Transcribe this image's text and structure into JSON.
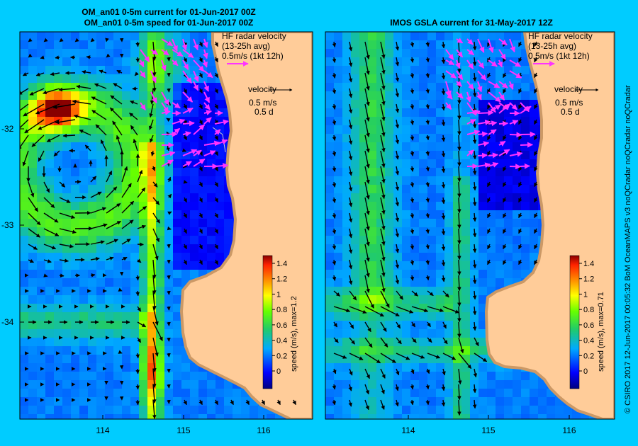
{
  "left_panel": {
    "title_line1": "OM_an01 0-5m current for 01-Jun-2017 00Z",
    "title_line2": "OM_an01 0-5m speed for 01-Jun-2017 00Z",
    "hf_legend": [
      "HF radar velocity",
      "(13-25h avg)",
      "0.5m/s (1kt 12h)"
    ],
    "velocity_legend": [
      "velocity",
      "0.5 m/s",
      "0.5 d"
    ],
    "colorbar_label": "speed (m/s), max=1.2",
    "lat_labels": [
      "-32",
      "-33",
      "-34"
    ],
    "lon_labels": [
      "114",
      "115",
      "116"
    ]
  },
  "right_panel": {
    "title": "IMOS GSLA current for 31-May-2017 12Z",
    "hf_legend": [
      "HF radar velocity",
      "(13-25h avg)",
      "0.5m/s (1kt 12h)"
    ],
    "velocity_legend": [
      "velocity",
      "0.5 m/s",
      "0.5 d"
    ],
    "colorbar_label": "speed (m/s), max=0.71",
    "lon_labels": [
      "114",
      "115",
      "116"
    ]
  },
  "colorbar_ticks": [
    "1.4",
    "1.2",
    "1",
    "0.8",
    "0.6",
    "0.4",
    "0.2",
    "0"
  ],
  "credit": "© CSIRO 2017   12-Jun-2017 00:05:32 BoM OceanMAPS v3 noQCradar noQCradar noQCradar",
  "colors": {
    "background": "#00ccff",
    "land": "#ffcc99",
    "shelf": "#cc9966",
    "radar_vector": "#ff33ff",
    "model_vector": "#000000"
  },
  "map_data": {
    "lon_range": [
      113,
      116.6
    ],
    "lat_range": [
      -35.1,
      -31.4
    ]
  }
}
